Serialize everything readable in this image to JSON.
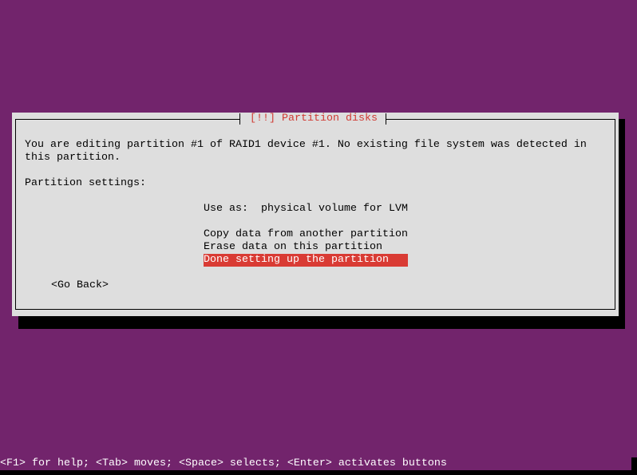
{
  "dialog": {
    "title": "[!!] Partition disks",
    "description_line1": "You are editing partition #1 of RAID1 device #1. No existing file system was detected in",
    "description_line2": "this partition.",
    "settings_heading": "Partition settings:",
    "settings": [
      {
        "label": "Use as:",
        "value": "physical volume for LVM"
      }
    ],
    "actions": [
      {
        "label": "Copy data from another partition",
        "selected": false
      },
      {
        "label": "Erase data on this partition",
        "selected": false
      },
      {
        "label": "Done setting up the partition",
        "selected": true
      }
    ],
    "go_back_label": "<Go Back>"
  },
  "status_bar": {
    "text": "<F1> for help; <Tab> moves; <Space> selects; <Enter> activates buttons"
  },
  "colors": {
    "background": "#72246c",
    "dialog": "#dedede",
    "title": "#d03a33",
    "selection": "#d93b34"
  }
}
